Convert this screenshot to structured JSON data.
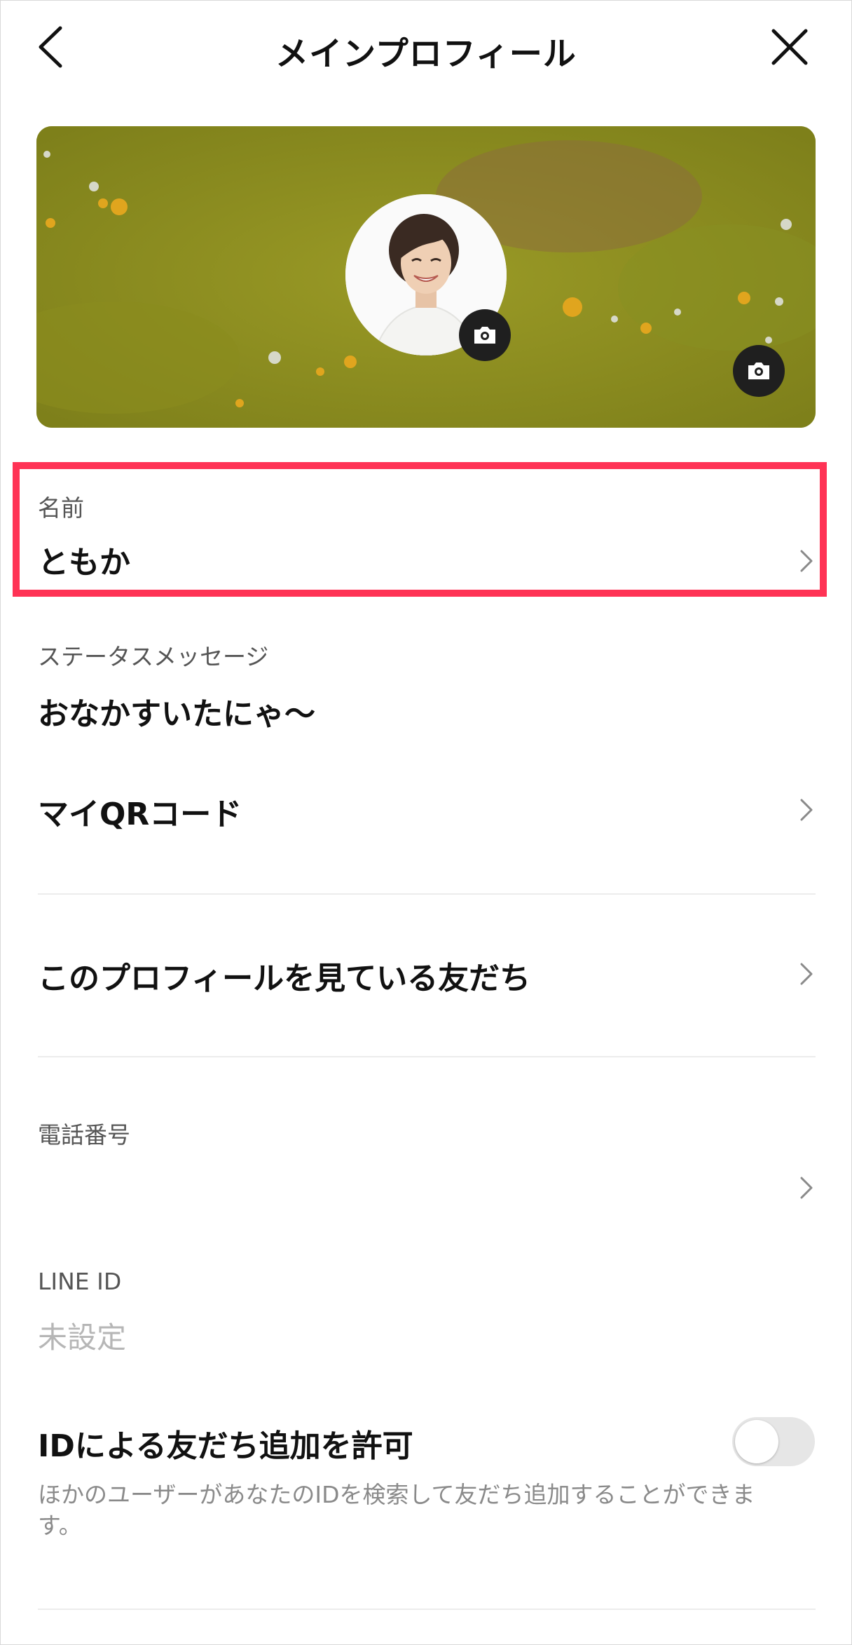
{
  "header": {
    "title": "メインプロフィール",
    "back_icon": "chevron-left-icon",
    "close_icon": "close-icon"
  },
  "cover": {
    "background_color": "#8e8f1f",
    "camera_icon": "camera-icon"
  },
  "name_section": {
    "label": "名前",
    "value": "ともか",
    "highlight_color": "#ff3355"
  },
  "status_section": {
    "label": "ステータスメッセージ",
    "value": "おなかすいたにゃ〜"
  },
  "rows": {
    "qr_code": "マイQRコード",
    "viewers": "このプロフィールを見ている友だち"
  },
  "phone_section": {
    "label": "電話番号"
  },
  "line_id_section": {
    "label": "LINE ID",
    "value": "未設定"
  },
  "id_search": {
    "label": "IDによる友だち追加を許可",
    "enabled": false,
    "help": "ほかのユーザーがあなたのIDを検索して友だち追加することができます。"
  }
}
